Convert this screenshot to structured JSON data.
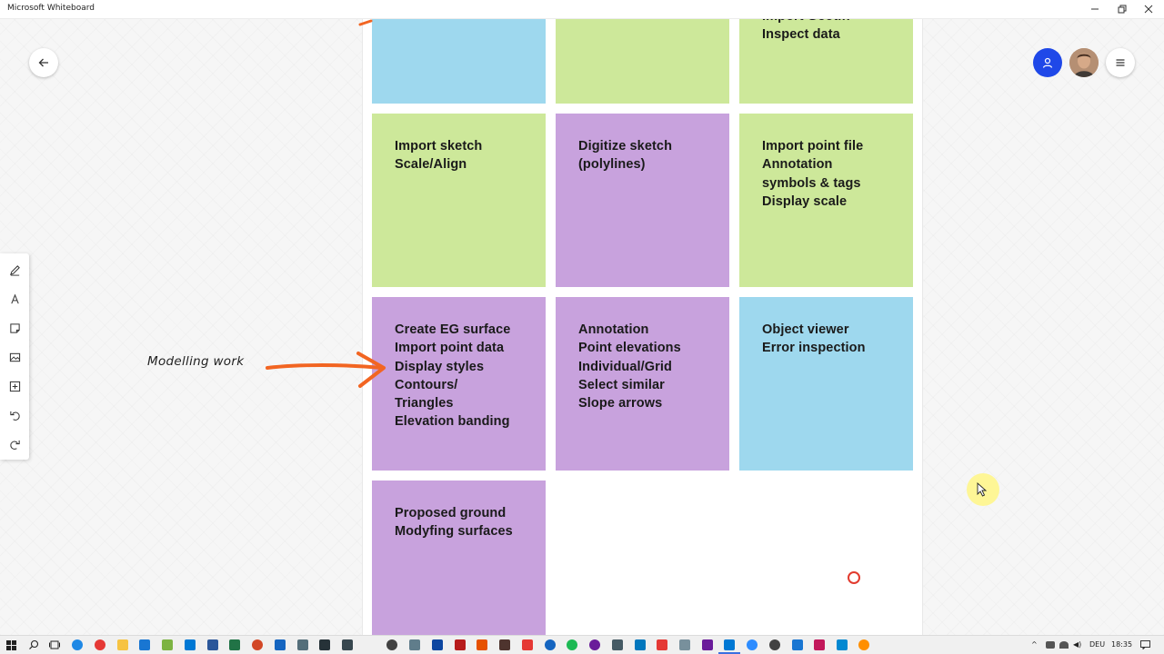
{
  "window": {
    "title": "Microsoft Whiteboard"
  },
  "notes": [
    {
      "id": "n1",
      "color": "blue",
      "text": ""
    },
    {
      "id": "n2",
      "color": "green",
      "text": ""
    },
    {
      "id": "n3",
      "color": "green",
      "text": "Import Geotiff\nInspect data"
    },
    {
      "id": "n4",
      "color": "green",
      "text": "Import sketch\nScale/Align"
    },
    {
      "id": "n5",
      "color": "purple",
      "text": "Digitize sketch\n(polylines)"
    },
    {
      "id": "n6",
      "color": "green",
      "text": "Import point file\nAnnotation\nsymbols & tags\nDisplay scale"
    },
    {
      "id": "n7",
      "color": "purple",
      "text": "Create EG surface\nImport point data\nDisplay styles\nContours/\nTriangles\nElevation banding"
    },
    {
      "id": "n8",
      "color": "purple",
      "text": "Annotation\nPoint elevations\nIndividual/Grid\nSelect similar\nSlope arrows"
    },
    {
      "id": "n9",
      "color": "blue",
      "text": "Object viewer\nError inspection"
    },
    {
      "id": "n10",
      "color": "purple",
      "text": "Proposed ground\nModyfing surfaces"
    }
  ],
  "annotation": {
    "text": "Modelling work",
    "arrow_color": "#f26522"
  },
  "colors": {
    "blue_note": "#9ed8ee",
    "green_note": "#cde89a",
    "purple_note": "#c8a2dd",
    "share_button": "#1f48e8",
    "ink": "#f26522"
  },
  "toolbar": [
    "pen-icon",
    "text-icon",
    "note-icon",
    "image-icon",
    "add-icon",
    "undo-icon",
    "redo-icon"
  ],
  "taskbar": {
    "language": "DEU",
    "time": "18:35"
  }
}
